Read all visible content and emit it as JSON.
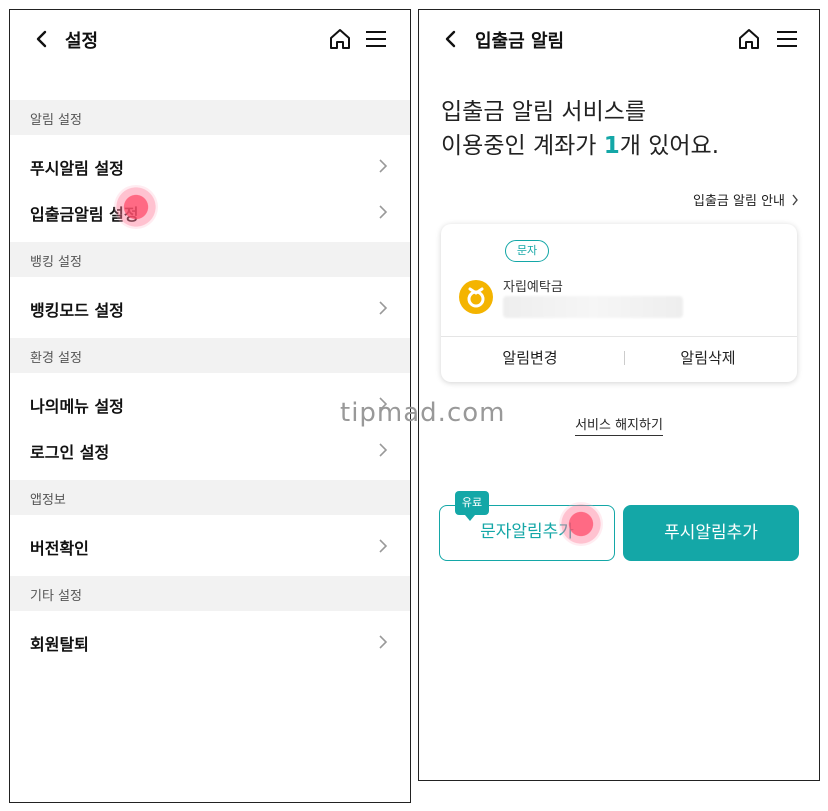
{
  "left": {
    "header": {
      "title": "설정",
      "back_icon": "chevron-left-icon",
      "home_icon": "home-icon",
      "menu_icon": "hamburger-menu-icon"
    },
    "sections": [
      {
        "title": "알림 설정",
        "items": [
          "푸시알림 설정",
          "입출금알림 설정"
        ]
      },
      {
        "title": "뱅킹 설정",
        "items": [
          "뱅킹모드 설정"
        ]
      },
      {
        "title": "환경 설정",
        "items": [
          "나의메뉴 설정",
          "로그인 설정"
        ]
      },
      {
        "title": "앱정보",
        "items": [
          "버전확인"
        ]
      },
      {
        "title": "기타 설정",
        "items": [
          "회원탈퇴"
        ]
      }
    ]
  },
  "watermark": "tipmad.com",
  "right": {
    "header": {
      "title": "입출금 알림",
      "back_icon": "chevron-left-icon",
      "home_icon": "home-icon",
      "menu_icon": "hamburger-menu-icon"
    },
    "headline_line1": "입출금 알림 서비스를",
    "headline_line2_pre": "이용중인 계좌가 ",
    "headline_count": "1",
    "headline_line2_post": "개 있어요.",
    "guide_link": "입출금 알림 안내",
    "card": {
      "badge": "문자",
      "account_name": "자립예탁금",
      "buttons": [
        "알림변경",
        "알림삭제"
      ]
    },
    "cancel_link": "서비스 해지하기",
    "paid_tag": "유료",
    "sms_button": "문자알림추가",
    "push_button": "푸시알림추가",
    "colors": {
      "accent": "#14a7a7",
      "bank_logo": "#f4b400"
    }
  }
}
